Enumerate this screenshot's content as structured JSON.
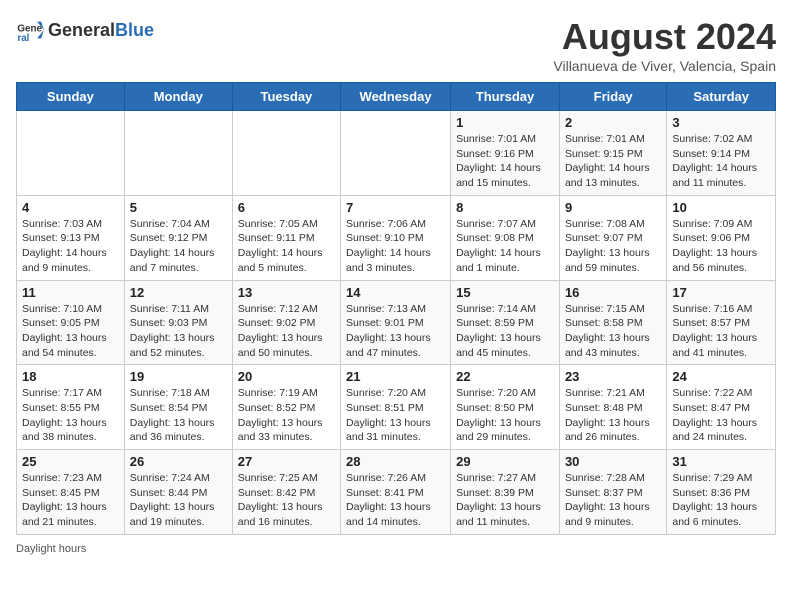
{
  "header": {
    "logo_general": "General",
    "logo_blue": "Blue",
    "month_year": "August 2024",
    "location": "Villanueva de Viver, Valencia, Spain"
  },
  "days_of_week": [
    "Sunday",
    "Monday",
    "Tuesday",
    "Wednesday",
    "Thursday",
    "Friday",
    "Saturday"
  ],
  "weeks": [
    [
      {
        "day": "",
        "info": ""
      },
      {
        "day": "",
        "info": ""
      },
      {
        "day": "",
        "info": ""
      },
      {
        "day": "",
        "info": ""
      },
      {
        "day": "1",
        "info": "Sunrise: 7:01 AM\nSunset: 9:16 PM\nDaylight: 14 hours\nand 15 minutes."
      },
      {
        "day": "2",
        "info": "Sunrise: 7:01 AM\nSunset: 9:15 PM\nDaylight: 14 hours\nand 13 minutes."
      },
      {
        "day": "3",
        "info": "Sunrise: 7:02 AM\nSunset: 9:14 PM\nDaylight: 14 hours\nand 11 minutes."
      }
    ],
    [
      {
        "day": "4",
        "info": "Sunrise: 7:03 AM\nSunset: 9:13 PM\nDaylight: 14 hours\nand 9 minutes."
      },
      {
        "day": "5",
        "info": "Sunrise: 7:04 AM\nSunset: 9:12 PM\nDaylight: 14 hours\nand 7 minutes."
      },
      {
        "day": "6",
        "info": "Sunrise: 7:05 AM\nSunset: 9:11 PM\nDaylight: 14 hours\nand 5 minutes."
      },
      {
        "day": "7",
        "info": "Sunrise: 7:06 AM\nSunset: 9:10 PM\nDaylight: 14 hours\nand 3 minutes."
      },
      {
        "day": "8",
        "info": "Sunrise: 7:07 AM\nSunset: 9:08 PM\nDaylight: 14 hours\nand 1 minute."
      },
      {
        "day": "9",
        "info": "Sunrise: 7:08 AM\nSunset: 9:07 PM\nDaylight: 13 hours\nand 59 minutes."
      },
      {
        "day": "10",
        "info": "Sunrise: 7:09 AM\nSunset: 9:06 PM\nDaylight: 13 hours\nand 56 minutes."
      }
    ],
    [
      {
        "day": "11",
        "info": "Sunrise: 7:10 AM\nSunset: 9:05 PM\nDaylight: 13 hours\nand 54 minutes."
      },
      {
        "day": "12",
        "info": "Sunrise: 7:11 AM\nSunset: 9:03 PM\nDaylight: 13 hours\nand 52 minutes."
      },
      {
        "day": "13",
        "info": "Sunrise: 7:12 AM\nSunset: 9:02 PM\nDaylight: 13 hours\nand 50 minutes."
      },
      {
        "day": "14",
        "info": "Sunrise: 7:13 AM\nSunset: 9:01 PM\nDaylight: 13 hours\nand 47 minutes."
      },
      {
        "day": "15",
        "info": "Sunrise: 7:14 AM\nSunset: 8:59 PM\nDaylight: 13 hours\nand 45 minutes."
      },
      {
        "day": "16",
        "info": "Sunrise: 7:15 AM\nSunset: 8:58 PM\nDaylight: 13 hours\nand 43 minutes."
      },
      {
        "day": "17",
        "info": "Sunrise: 7:16 AM\nSunset: 8:57 PM\nDaylight: 13 hours\nand 41 minutes."
      }
    ],
    [
      {
        "day": "18",
        "info": "Sunrise: 7:17 AM\nSunset: 8:55 PM\nDaylight: 13 hours\nand 38 minutes."
      },
      {
        "day": "19",
        "info": "Sunrise: 7:18 AM\nSunset: 8:54 PM\nDaylight: 13 hours\nand 36 minutes."
      },
      {
        "day": "20",
        "info": "Sunrise: 7:19 AM\nSunset: 8:52 PM\nDaylight: 13 hours\nand 33 minutes."
      },
      {
        "day": "21",
        "info": "Sunrise: 7:20 AM\nSunset: 8:51 PM\nDaylight: 13 hours\nand 31 minutes."
      },
      {
        "day": "22",
        "info": "Sunrise: 7:20 AM\nSunset: 8:50 PM\nDaylight: 13 hours\nand 29 minutes."
      },
      {
        "day": "23",
        "info": "Sunrise: 7:21 AM\nSunset: 8:48 PM\nDaylight: 13 hours\nand 26 minutes."
      },
      {
        "day": "24",
        "info": "Sunrise: 7:22 AM\nSunset: 8:47 PM\nDaylight: 13 hours\nand 24 minutes."
      }
    ],
    [
      {
        "day": "25",
        "info": "Sunrise: 7:23 AM\nSunset: 8:45 PM\nDaylight: 13 hours\nand 21 minutes."
      },
      {
        "day": "26",
        "info": "Sunrise: 7:24 AM\nSunset: 8:44 PM\nDaylight: 13 hours\nand 19 minutes."
      },
      {
        "day": "27",
        "info": "Sunrise: 7:25 AM\nSunset: 8:42 PM\nDaylight: 13 hours\nand 16 minutes."
      },
      {
        "day": "28",
        "info": "Sunrise: 7:26 AM\nSunset: 8:41 PM\nDaylight: 13 hours\nand 14 minutes."
      },
      {
        "day": "29",
        "info": "Sunrise: 7:27 AM\nSunset: 8:39 PM\nDaylight: 13 hours\nand 11 minutes."
      },
      {
        "day": "30",
        "info": "Sunrise: 7:28 AM\nSunset: 8:37 PM\nDaylight: 13 hours\nand 9 minutes."
      },
      {
        "day": "31",
        "info": "Sunrise: 7:29 AM\nSunset: 8:36 PM\nDaylight: 13 hours\nand 6 minutes."
      }
    ]
  ],
  "footer": {
    "label": "Daylight hours"
  }
}
